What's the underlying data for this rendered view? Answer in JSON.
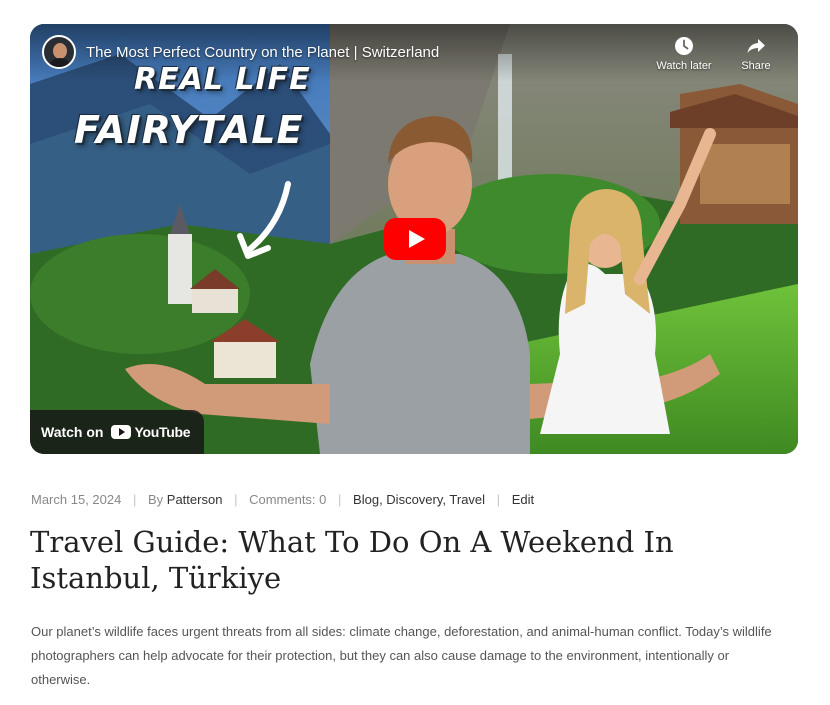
{
  "video": {
    "title": "The Most Perfect Country on the Planet | Switzerland",
    "watch_later_label": "Watch later",
    "share_label": "Share",
    "watch_on_label": "Watch on",
    "youtube_label": "YouTube",
    "thumbnail_text_line1": "REAL LIFE",
    "thumbnail_text_line2": "FAIRYTALE",
    "play_color": "#ff0000"
  },
  "post": {
    "date": "March 15, 2024",
    "by_label": "By",
    "author": "Patterson",
    "comments_label": "Comments: 0",
    "categories": [
      "Blog",
      "Discovery",
      "Travel"
    ],
    "edit_label": "Edit",
    "title": "Travel Guide: What To Do On A Weekend In Istanbul, Türkiye",
    "excerpt": "Our planet’s wildlife faces urgent threats from all sides: climate change, deforestation, and animal-human conflict. Today’s wildlife photographers can help advocate for their protection, but they can also cause damage to the environment, intentionally or otherwise."
  }
}
